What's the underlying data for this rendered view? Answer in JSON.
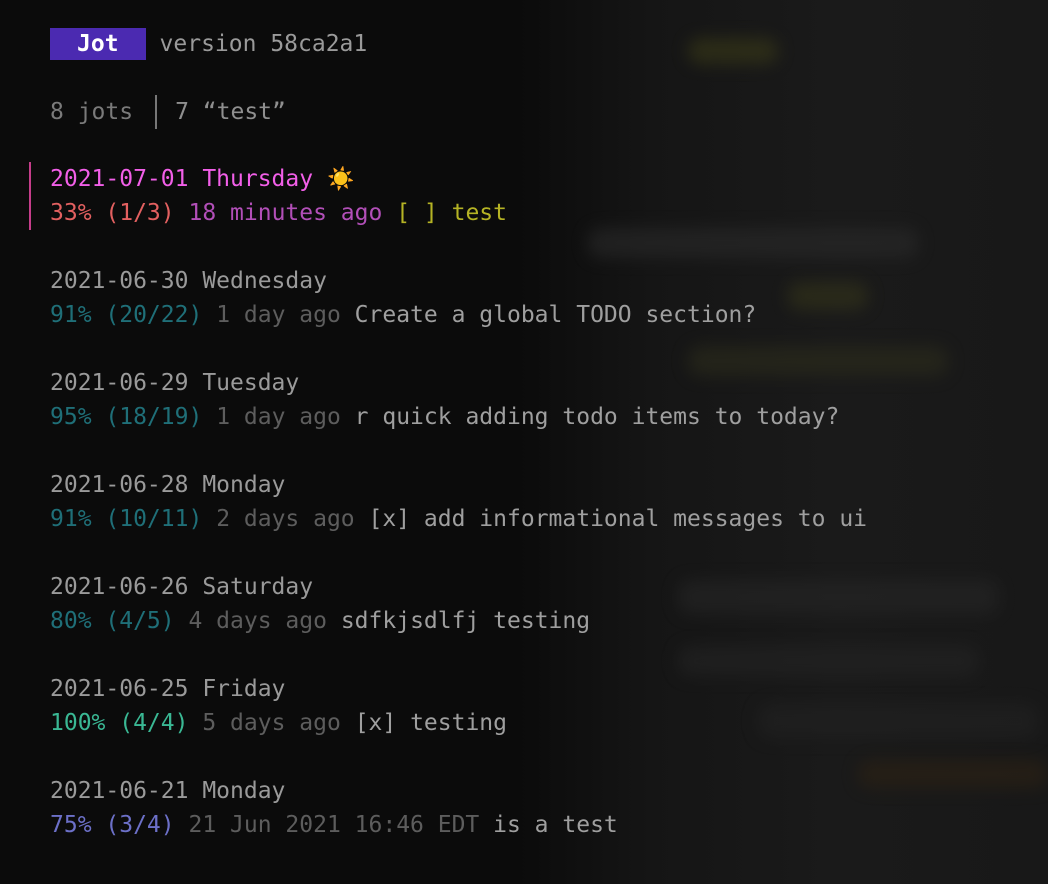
{
  "header": {
    "app_name": "Jot",
    "version_text": "version 58ca2a1"
  },
  "stats": {
    "count_text": "8 jots",
    "query_text": "7 “test”"
  },
  "jots": [
    {
      "date": "2021-07-01 Thursday",
      "day_icon": "☀️",
      "percent": "33% (1/3)",
      "ago": "18 minutes ago",
      "summary": "[ ] test",
      "selected": true
    },
    {
      "date": "2021-06-30 Wednesday",
      "percent": "91% (20/22)",
      "ago": "1 day ago",
      "summary": "Create a global TODO section?"
    },
    {
      "date": "2021-06-29 Tuesday",
      "percent": "95% (18/19)",
      "ago": "1 day ago",
      "summary": "r quick adding todo items to today?"
    },
    {
      "date": "2021-06-28 Monday",
      "percent": "91% (10/11)",
      "ago": "2 days ago",
      "summary": "[x] add informational messages to ui"
    },
    {
      "date": "2021-06-26 Saturday",
      "percent": "80% (4/5)",
      "ago": "4 days ago",
      "summary": "sdfkjsdlfj testing"
    },
    {
      "date": "2021-06-25 Friday",
      "percent": "100% (4/4)",
      "ago": "5 days ago",
      "summary": "[x] testing"
    },
    {
      "date": "2021-06-21 Monday",
      "percent": "75% (3/4)",
      "ago": "21 Jun 2021 16:46 EDT",
      "summary": "is a test"
    }
  ],
  "colors": {
    "badge_bg": "#4b2ab1",
    "selected_date": "#f25fe8",
    "selected_summary": "#b5b324",
    "progress_red": "#e26060",
    "progress_teal": "#1f6f78",
    "progress_green": "#3ab894",
    "progress_blue": "#6c70c8"
  }
}
